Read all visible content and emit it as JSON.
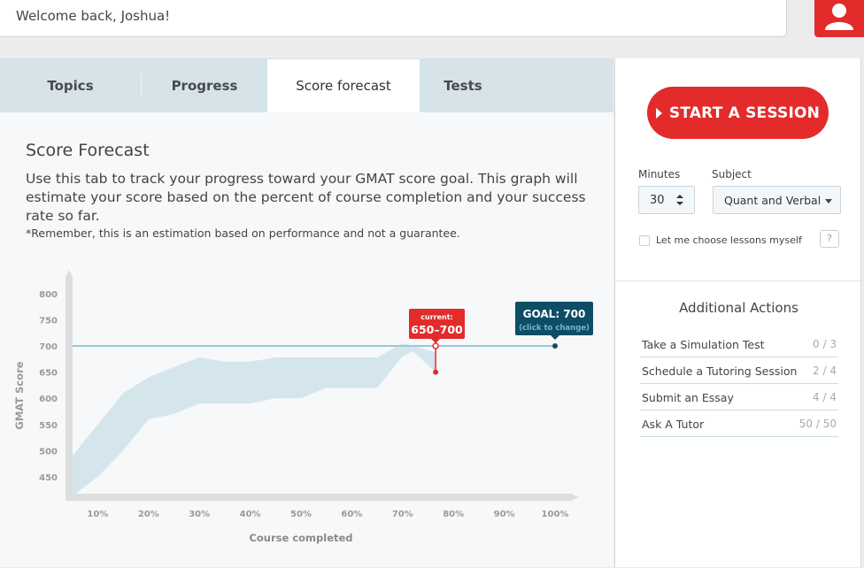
{
  "header": {
    "welcome": "Welcome back, Joshua!",
    "accent_color": "#e32b2b"
  },
  "tabs": [
    {
      "label": "Topics"
    },
    {
      "label": "Progress"
    },
    {
      "label": "Score forecast",
      "active": true
    },
    {
      "label": "Tests"
    }
  ],
  "main": {
    "title": "Score Forecast",
    "description": "Use this tab to track your progress toward your GMAT score goal. This graph will estimate your score based on the percent of course completion and your success rate so far.",
    "note": "*Remember, this is an estimation based on performance and not a guarantee."
  },
  "chart_data": {
    "type": "area",
    "xlabel": "Course completed",
    "ylabel": "GMAT Score",
    "x_ticks": [
      "10%",
      "20%",
      "30%",
      "40%",
      "50%",
      "60%",
      "70%",
      "80%",
      "90%",
      "100%"
    ],
    "y_ticks": [
      "450",
      "500",
      "550",
      "600",
      "650",
      "700",
      "750",
      "800"
    ],
    "band": {
      "x": [
        5,
        10,
        15,
        20,
        25,
        30,
        35,
        40,
        45,
        50,
        55,
        60,
        65,
        70,
        72,
        76.5
      ],
      "upper": [
        490,
        550,
        610,
        640,
        660,
        678,
        670,
        670,
        678,
        678,
        678,
        678,
        678,
        705,
        700,
        688
      ],
      "lower": [
        413,
        450,
        500,
        560,
        570,
        590,
        590,
        590,
        600,
        600,
        620,
        620,
        620,
        680,
        690,
        650
      ]
    },
    "goal_line": 700,
    "current": {
      "x": 76.5,
      "low": 650,
      "high": 700,
      "title": "current:",
      "label": "650–700"
    },
    "goal": {
      "x": 100,
      "value": 700,
      "title": "GOAL: 700",
      "sub": "(click to change)"
    },
    "colors": {
      "band": "#d4e6ec",
      "goal": "#0f4d66",
      "current": "#e32b2b",
      "line": "#9bc6d6"
    }
  },
  "session": {
    "start_label": "START A SESSION",
    "minutes_label": "Minutes",
    "minutes_value": "30",
    "subject_label": "Subject",
    "subject_value": "Quant and Verbal",
    "choose_label": "Let me choose lessons myself",
    "help": "?"
  },
  "additional": {
    "title": "Additional Actions",
    "items": [
      {
        "name": "Take a Simulation Test",
        "count": "0 / 3"
      },
      {
        "name": "Schedule a Tutoring Session",
        "count": "2 / 4"
      },
      {
        "name": "Submit an Essay",
        "count": "4 / 4"
      },
      {
        "name": "Ask A Tutor",
        "count": "50 / 50"
      }
    ]
  }
}
